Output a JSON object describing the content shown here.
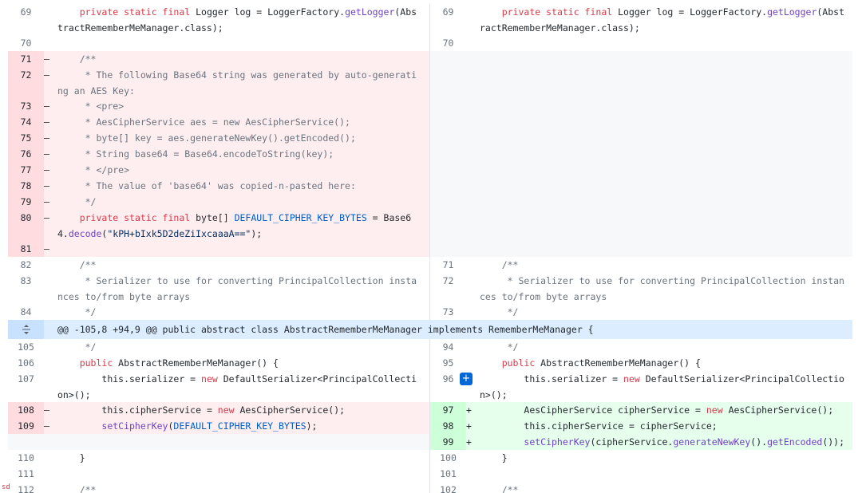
{
  "hunk_header": "@@ -105,8 +94,9 @@ public abstract class AbstractRememberMeManager implements RememberMeManager {",
  "watermark": "",
  "corner_text": "sd",
  "rows_top": [
    {
      "type": "ctx",
      "ln": "69",
      "rn": "69",
      "l": [
        [
          "    ",
          ""
        ],
        [
          "private static final",
          "kw"
        ],
        [
          " Logger log = LoggerFactory.",
          ""
        ],
        [
          "getLogger",
          "fn"
        ],
        [
          "(AbstractRememberMeManager.class);",
          ""
        ]
      ],
      "r": [
        [
          "    ",
          ""
        ],
        [
          "private static final",
          "kw"
        ],
        [
          " Logger log = LoggerFactory.",
          ""
        ],
        [
          "getLogger",
          "fn"
        ],
        [
          "(AbstractRememberMeManager.class);",
          ""
        ]
      ],
      "h": 39
    },
    {
      "type": "ctx",
      "ln": "70",
      "rn": "70",
      "l": [],
      "r": [],
      "h": 20
    },
    {
      "type": "del",
      "ln": "71",
      "l": [
        [
          "    /**",
          "cm"
        ]
      ],
      "h": 20
    },
    {
      "type": "del",
      "ln": "72",
      "l": [
        [
          "     * The following Base64 string was generated by auto-generating an AES Key:",
          "cm"
        ]
      ],
      "h": 39
    },
    {
      "type": "del",
      "ln": "73",
      "l": [
        [
          "     * <pre>",
          "cm"
        ]
      ],
      "h": 20
    },
    {
      "type": "del",
      "ln": "74",
      "l": [
        [
          "     * AesCipherService aes = new AesCipherService();",
          "cm"
        ]
      ],
      "h": 20
    },
    {
      "type": "del",
      "ln": "75",
      "l": [
        [
          "     * byte[] key = aes.generateNewKey().getEncoded();",
          "cm"
        ]
      ],
      "h": 20
    },
    {
      "type": "del",
      "ln": "76",
      "l": [
        [
          "     * String base64 = Base64.encodeToString(key);",
          "cm"
        ]
      ],
      "h": 20
    },
    {
      "type": "del",
      "ln": "77",
      "l": [
        [
          "     * </pre>",
          "cm"
        ]
      ],
      "h": 20
    },
    {
      "type": "del",
      "ln": "78",
      "l": [
        [
          "     * The value of 'base64' was copied-n-pasted here:",
          "cm"
        ]
      ],
      "h": 20
    },
    {
      "type": "del",
      "ln": "79",
      "l": [
        [
          "     */",
          "cm"
        ]
      ],
      "h": 20
    },
    {
      "type": "del",
      "ln": "80",
      "l": [
        [
          "    ",
          ""
        ],
        [
          "private static final",
          "kw"
        ],
        [
          " byte[] ",
          ""
        ],
        [
          "DEFAULT_CIPHER_KEY_BYTES",
          "cn"
        ],
        [
          " = Base64.",
          ""
        ],
        [
          "decode",
          "fn"
        ],
        [
          "(",
          ""
        ],
        [
          "\"kPH+bIxk5D2deZiIxcaaaA==\"",
          "st"
        ],
        [
          ");",
          ""
        ]
      ],
      "h": 39
    },
    {
      "type": "del",
      "ln": "81",
      "l": [],
      "h": 20
    },
    {
      "type": "ctx",
      "ln": "82",
      "rn": "71",
      "l": [
        [
          "    /**",
          "cm"
        ]
      ],
      "r": [
        [
          "    /**",
          "cm"
        ]
      ],
      "h": 20
    },
    {
      "type": "ctx",
      "ln": "83",
      "rn": "72",
      "l": [
        [
          "     * Serializer to use for converting PrincipalCollection instances to/from byte arrays",
          "cm"
        ]
      ],
      "r": [
        [
          "     * Serializer to use for converting PrincipalCollection instances to/from byte arrays",
          "cm"
        ]
      ],
      "h": 39
    },
    {
      "type": "ctx",
      "ln": "84",
      "rn": "73",
      "l": [
        [
          "     */",
          "cm"
        ]
      ],
      "r": [
        [
          "     */",
          "cm"
        ]
      ],
      "h": 20
    }
  ],
  "rows_bottom": [
    {
      "type": "ctx",
      "ln": "105",
      "rn": "94",
      "l": [
        [
          "     */",
          "cm"
        ]
      ],
      "r": [
        [
          "     */",
          "cm"
        ]
      ],
      "h": 20
    },
    {
      "type": "ctx",
      "ln": "106",
      "rn": "95",
      "l": [
        [
          "    ",
          ""
        ],
        [
          "public",
          "kw"
        ],
        [
          " AbstractRememberMeManager() {",
          ""
        ]
      ],
      "r": [
        [
          "    ",
          ""
        ],
        [
          "public",
          "kw"
        ],
        [
          " AbstractRememberMeManager() {",
          ""
        ]
      ],
      "h": 20
    },
    {
      "type": "ctx",
      "ln": "107",
      "rn": "96",
      "plus": true,
      "l": [
        [
          "        this.serializer = ",
          ""
        ],
        [
          "new",
          "kw"
        ],
        [
          " DefaultSerializer<PrincipalCollection>();",
          ""
        ]
      ],
      "r": [
        [
          "        this.serializer = ",
          ""
        ],
        [
          "new",
          "kw"
        ],
        [
          " DefaultSerializer<PrincipalCollection>();",
          ""
        ]
      ],
      "h": 39
    },
    {
      "type": "mod",
      "ln": "108",
      "rn": "97",
      "l": [
        [
          "        this.cipherService = ",
          ""
        ],
        [
          "new",
          "kw"
        ],
        [
          " AesCipherService();",
          ""
        ]
      ],
      "r": [
        [
          "        AesCipherService cipherService = ",
          ""
        ],
        [
          "new",
          "kw"
        ],
        [
          " AesCipherService();",
          ""
        ]
      ],
      "h": 20
    },
    {
      "type": "mod",
      "ln": "109",
      "rn": "98",
      "l": [
        [
          "        ",
          ""
        ],
        [
          "setCipherKey",
          "fn"
        ],
        [
          "(",
          ""
        ],
        [
          "DEFAULT_CIPHER_KEY_BYTES",
          "cn"
        ],
        [
          ");",
          ""
        ]
      ],
      "r": [
        [
          "        this.cipherService = cipherService;",
          ""
        ]
      ],
      "h": 20
    },
    {
      "type": "addonly",
      "rn": "99",
      "r": [
        [
          "        ",
          ""
        ],
        [
          "setCipherKey",
          "fn"
        ],
        [
          "(cipherService.",
          ""
        ],
        [
          "generateNewKey",
          "fn"
        ],
        [
          "().",
          ""
        ],
        [
          "getEncoded",
          "fn"
        ],
        [
          "());",
          ""
        ]
      ],
      "h": 20
    },
    {
      "type": "ctx",
      "ln": "110",
      "rn": "100",
      "l": [
        [
          "    }",
          ""
        ]
      ],
      "r": [
        [
          "    }",
          ""
        ]
      ],
      "h": 20
    },
    {
      "type": "ctx",
      "ln": "111",
      "rn": "101",
      "l": [],
      "r": [],
      "h": 20
    },
    {
      "type": "ctx",
      "ln": "112",
      "rn": "102",
      "l": [
        [
          "    /**",
          "cm"
        ]
      ],
      "r": [
        [
          "    /**",
          "cm"
        ]
      ],
      "h": 20
    }
  ]
}
